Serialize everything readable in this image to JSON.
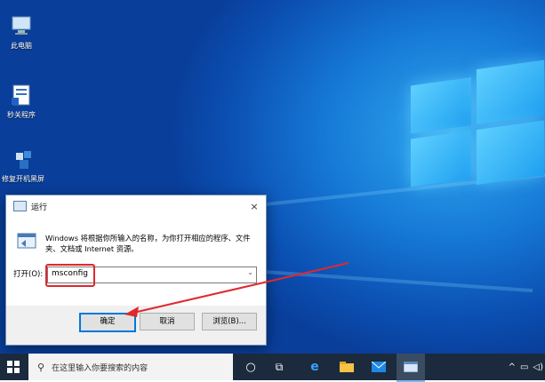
{
  "desktop": {
    "icons": [
      {
        "label": "此电脑"
      },
      {
        "label": "秒关程序"
      },
      {
        "label": "修复开机黑屏"
      }
    ]
  },
  "run_dialog": {
    "title": "运行",
    "close": "×",
    "description": "Windows 将根据你所输入的名称，为你打开相应的程序、文件夹、文档或 Internet 资源。",
    "open_label": "打开(O):",
    "input_value": "msconfig",
    "ok_label": "确定",
    "cancel_label": "取消",
    "browse_label": "浏览(B)..."
  },
  "taskbar": {
    "search_placeholder": "在这里输入你要搜索的内容",
    "tray_text": "^"
  }
}
